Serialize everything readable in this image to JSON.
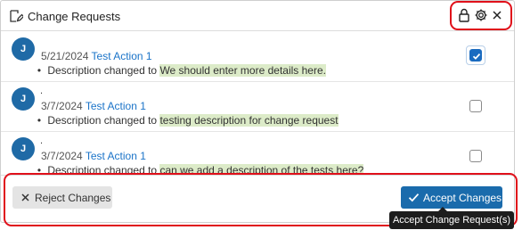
{
  "panel": {
    "title": "Change Requests",
    "icons": {
      "title": "edit-note-icon",
      "lock": "lock-icon",
      "settings": "gear-icon",
      "close": "close-icon"
    }
  },
  "items": [
    {
      "avatar": "J",
      "dot": "",
      "date": "5/21/2024",
      "action": "Test Action 1",
      "desc_prefix": "Description changed to",
      "desc_value": "We should enter more details here.",
      "checked": true
    },
    {
      "avatar": "J",
      "dot": ".",
      "date": "3/7/2024",
      "action": "Test Action 1",
      "desc_prefix": "Description changed to",
      "desc_value": "testing description for change request",
      "checked": false
    },
    {
      "avatar": "J",
      "dot": ".",
      "date": "3/7/2024",
      "action": "Test Action 1",
      "desc_prefix": "Description changed to",
      "desc_value": "can we add a description of the tests here?",
      "checked": false
    }
  ],
  "footer": {
    "reject_label": "Reject Changes",
    "accept_label": "Accept Changes",
    "tooltip": "Accept Change Request(s)"
  },
  "colors": {
    "accent": "#1a6bac",
    "highlight": "#dcebc8",
    "annotation": "#e0101a",
    "link": "#1a73c8"
  }
}
